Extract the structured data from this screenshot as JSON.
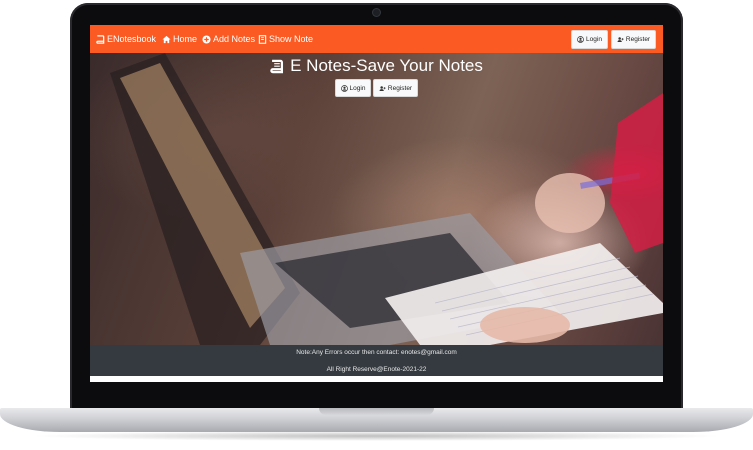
{
  "navbar": {
    "brand_label": "ENotesbook",
    "home_label": "Home",
    "add_notes_label": "Add Notes",
    "show_notes_label": "Show Note",
    "login_label": "Login",
    "register_label": "Register",
    "brand_icon": "book-icon",
    "home_icon": "home-icon",
    "add_icon": "plus-circle-icon",
    "show_icon": "book-open-icon",
    "background_color": "#fb5a23"
  },
  "hero": {
    "title": "E Notes-Save Your Notes",
    "title_icon": "book-icon",
    "login_label": "Login",
    "register_label": "Register",
    "login_icon": "user-circle-icon",
    "register_icon": "user-plus-icon"
  },
  "footer": {
    "note_text": "Note:Any Errors occur then contact: enotes@gmail.com",
    "rights_text": "All Right Reserve@Enote-2021-22",
    "background_color": "#343a40"
  }
}
